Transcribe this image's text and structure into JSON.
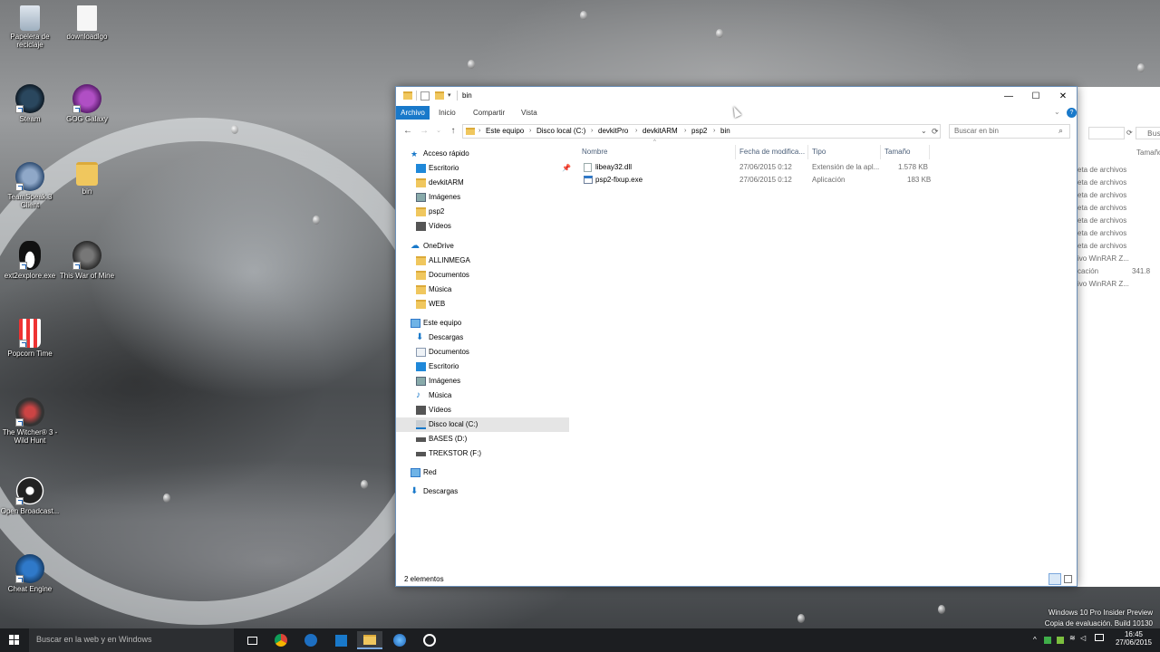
{
  "desktop": {
    "icons": [
      {
        "label": "Papelera de reciclaje"
      },
      {
        "label": "downloadlgo"
      },
      {
        "label": "Steam"
      },
      {
        "label": "GOG Galaxy"
      },
      {
        "label": "TeamSpeak 3 Client"
      },
      {
        "label": "bin"
      },
      {
        "label": "ext2explore.exe"
      },
      {
        "label": "This War of Mine"
      },
      {
        "label": "Popcorn Time"
      },
      {
        "label": "The Witcher® 3 - Wild Hunt"
      },
      {
        "label": "Open Broadcast..."
      },
      {
        "label": "Cheat Engine"
      }
    ]
  },
  "background_window": {
    "search_placeholder": "Bus",
    "col_size": "Tamaño",
    "rows": [
      "eta de archivos",
      "eta de archivos",
      "eta de archivos",
      "eta de archivos",
      "eta de archivos",
      "eta de archivos",
      "eta de archivos",
      "ivo WinRAR Z...",
      "cación",
      "ivo WinRAR Z..."
    ],
    "size_value": "341.8"
  },
  "window": {
    "title": "bin",
    "controls": {
      "minimize": "—",
      "maximize": "☐",
      "close": "✕"
    },
    "ribbon": {
      "file": "Archivo",
      "home": "Inicio",
      "share": "Compartir",
      "view": "Vista"
    },
    "breadcrumb": [
      "Este equipo",
      "Disco local (C:)",
      "devkitPro",
      "devkitARM",
      "psp2",
      "bin"
    ],
    "search_placeholder": "Buscar en bin",
    "nav": {
      "quick_access": "Acceso rápido",
      "quick_items": [
        "Escritorio",
        "devkitARM",
        "Imágenes",
        "psp2",
        "Vídeos"
      ],
      "onedrive": "OneDrive",
      "onedrive_items": [
        "ALLINMEGA",
        "Documentos",
        "Música",
        "WEB"
      ],
      "this_pc": "Este equipo",
      "pc_items": [
        "Descargas",
        "Documentos",
        "Escritorio",
        "Imágenes",
        "Música",
        "Vídeos",
        "Disco local (C:)",
        "BASES (D:)",
        "TREKSTOR (F:)"
      ],
      "network": "Red",
      "downloads": "Descargas"
    },
    "columns": {
      "name": "Nombre",
      "date": "Fecha de modifica...",
      "type": "Tipo",
      "size": "Tamaño"
    },
    "files": [
      {
        "name": "libeay32.dll",
        "date": "27/06/2015 0:12",
        "type": "Extensión de la apl...",
        "size": "1.578 KB"
      },
      {
        "name": "psp2-fixup.exe",
        "date": "27/06/2015 0:12",
        "type": "Aplicación",
        "size": "183 KB"
      }
    ],
    "status": "2 elementos"
  },
  "taskbar": {
    "search_placeholder": "Buscar en la web y en Windows",
    "time": "16:45",
    "date": "27/06/2015"
  },
  "watermark": {
    "line1": "Windows 10 Pro Insider Preview",
    "line2": "Copia de evaluación. Build 10130"
  },
  "colors": {
    "accent": "#1979ca",
    "folder": "#f0c75e",
    "taskbar": "#1c1e21"
  }
}
